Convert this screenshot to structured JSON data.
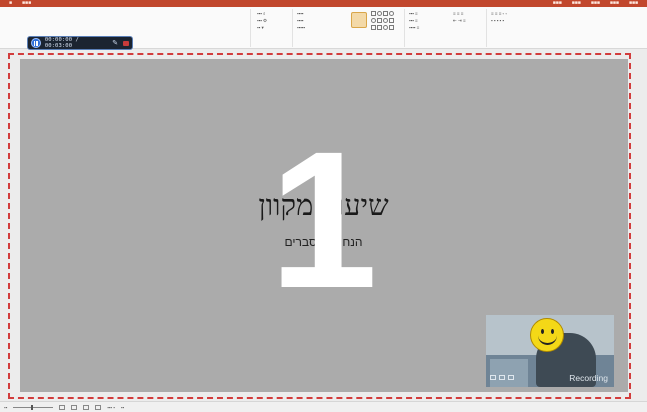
{
  "recorder": {
    "elapsed": "00:00:00",
    "separator": "/",
    "total": "00:03:00"
  },
  "slide": {
    "title": "שיעור מקוון",
    "subtitle": "הנחיות הסברים",
    "overlay_number": "1"
  },
  "webcam": {
    "status_label": "Recording"
  },
  "colors": {
    "record_frame": "#d23c3c",
    "slide_bg": "#ababab",
    "titlebar": "#c1472d",
    "recbar_bg": "#1b2431"
  },
  "icons": {
    "pause": "pause-icon",
    "pen": "pen-icon",
    "camera": "camera-icon",
    "smiley": "smiley-face-icon"
  }
}
